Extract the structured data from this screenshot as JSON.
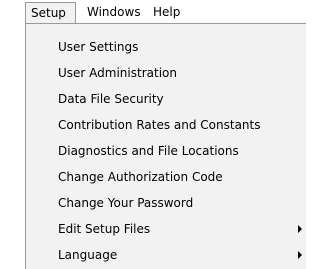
{
  "menubar": {
    "items": [
      {
        "label": "Setup"
      },
      {
        "label": "Windows"
      },
      {
        "label": "Help"
      }
    ]
  },
  "setup_menu": {
    "items": [
      {
        "label": "User Settings"
      },
      {
        "label": "User Administration"
      },
      {
        "label": "Data File Security"
      },
      {
        "label": "Contribution Rates and Constants"
      },
      {
        "label": "Diagnostics and File Locations"
      },
      {
        "label": "Change Authorization Code"
      },
      {
        "label": "Change Your Password"
      },
      {
        "label": "Edit Setup Files",
        "icon": "submenu-arrow-icon"
      },
      {
        "label": "Language",
        "icon": "submenu-arrow-icon"
      }
    ]
  }
}
